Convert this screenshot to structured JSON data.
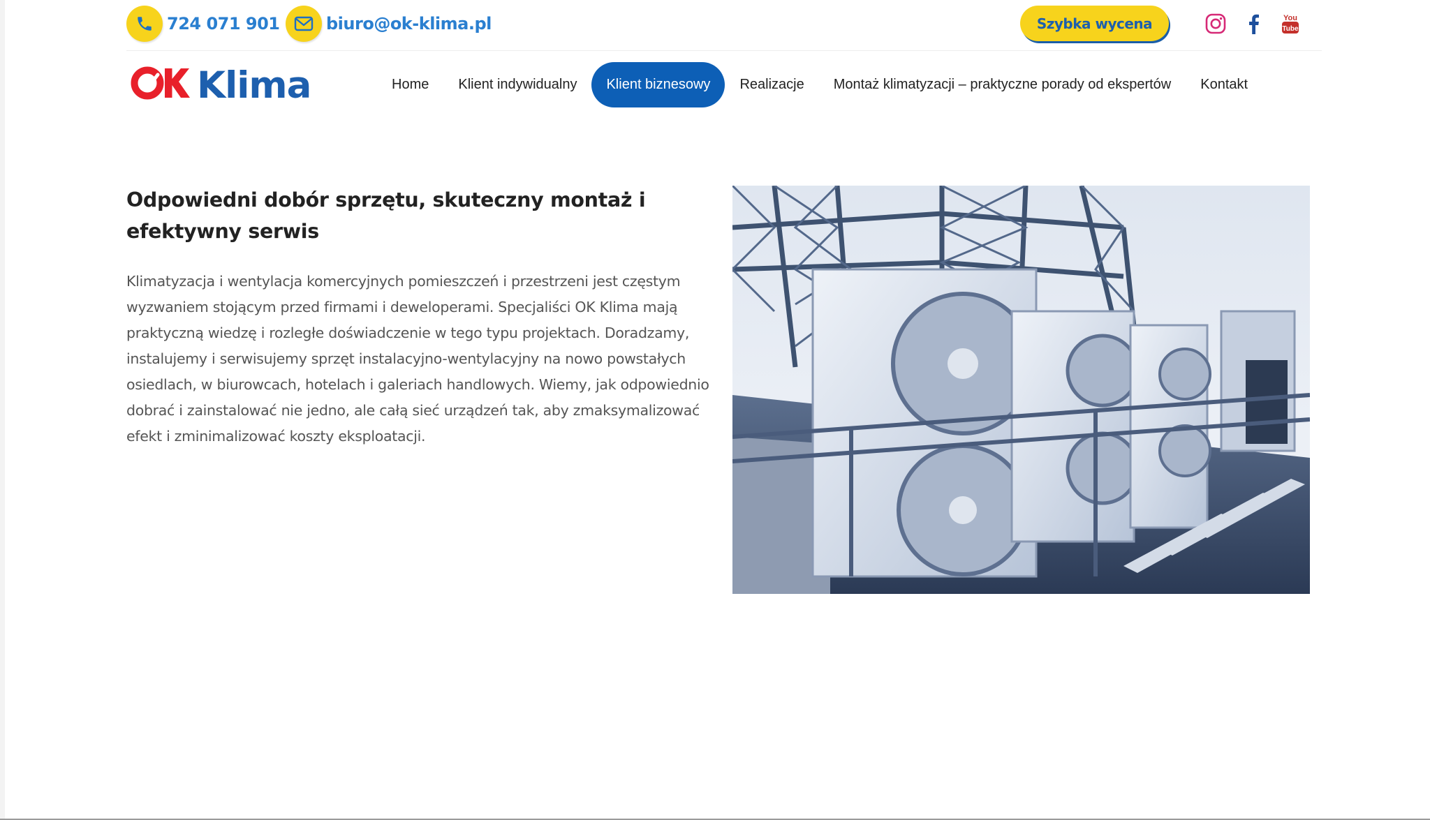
{
  "topbar": {
    "phone": {
      "icon": "phone-icon",
      "text": "724 071 901"
    },
    "email": {
      "icon": "envelope-icon",
      "text": "biuro@ok-klima.pl"
    },
    "quote_button": "Szybka wycena",
    "social": [
      {
        "name": "instagram-icon"
      },
      {
        "name": "facebook-icon"
      },
      {
        "name": "youtube-icon"
      }
    ]
  },
  "logo": {
    "part1": "OK",
    "part2": "Klima",
    "colors": {
      "red": "#e8202a",
      "blue": "#1d5fae"
    }
  },
  "nav": {
    "items": [
      {
        "label": "Home",
        "active": false
      },
      {
        "label": "Klient indywidualny",
        "active": false
      },
      {
        "label": "Klient biznesowy",
        "active": true
      },
      {
        "label": "Realizacje",
        "active": false
      },
      {
        "label": "Montaż klimatyzacji – praktyczne porady od ekspertów",
        "active": false
      },
      {
        "label": "Kontakt",
        "active": false
      }
    ]
  },
  "content": {
    "heading": "Odpowiedni dobór sprzętu, skuteczny montaż i efektywny serwis",
    "body": "Klimatyzacja i wentylacja komercyjnych pomieszczeń i przestrzeni jest częstym wyzwaniem stojącym przed firmami i deweloperami. Specjaliści OK Klima mają praktyczną wiedzę i rozległe doświadczenie w tego typu projektach. Doradzamy, instalujemy i serwisujemy sprzęt instalacyjno-wentylacyjny na nowo powstałych osiedlach, w biurowcach, hotelach i galeriach handlowych. Wiemy, jak odpowiednio dobrać i zainstalować nie jedno, ale całą sieć urządzeń tak, aby zmaksymalizować efekt i zminimalizować koszty eksploatacji."
  },
  "colors": {
    "accent_yellow": "#f7d31c",
    "brand_blue": "#0d5fb6",
    "link_blue": "#2a7fd0"
  }
}
